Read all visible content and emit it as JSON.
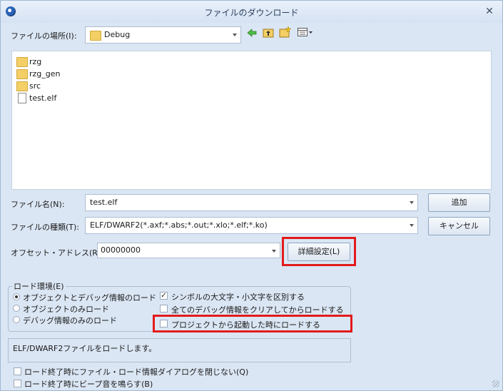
{
  "window": {
    "title": "ファイルのダウンロード",
    "close_glyph": "✕"
  },
  "location": {
    "label": "ファイルの場所(I):",
    "value": "Debug"
  },
  "toolbar": {
    "icons": [
      "back-arrow-icon",
      "up-folder-icon",
      "new-folder-icon",
      "view-menu-icon"
    ]
  },
  "files": [
    {
      "name": "rzg",
      "type": "folder"
    },
    {
      "name": "rzg_gen",
      "type": "folder"
    },
    {
      "name": "src",
      "type": "folder"
    },
    {
      "name": "test.elf",
      "type": "file"
    }
  ],
  "filename": {
    "label": "ファイル名(N):",
    "value": "test.elf"
  },
  "filetype": {
    "label": "ファイルの種類(T):",
    "value": "ELF/DWARF2(*.axf;*.abs;*.out;*.xlo;*.elf;*.ko)"
  },
  "offset": {
    "label": "オフセット・アドレス(R):",
    "value": "00000000"
  },
  "buttons": {
    "add": "追加",
    "cancel": "キャンセル",
    "details": "詳細設定(L)"
  },
  "load_env": {
    "title": "ロード環境(E)",
    "radios": [
      {
        "label": "オブジェクトとデバッグ情報のロード",
        "selected": true
      },
      {
        "label": "オブジェクトのみロード",
        "selected": false
      },
      {
        "label": "デバッグ情報のみのロード",
        "selected": false
      }
    ],
    "checks": [
      {
        "label": "シンボルの大文字・小文字を区別する",
        "checked": true
      },
      {
        "label": "全てのデバッグ情報をクリアしてからロードする",
        "checked": false
      },
      {
        "label": "プロジェクトから起動した時にロードする",
        "checked": false
      }
    ]
  },
  "status_text": "ELF/DWARF2ファイルをロードします。",
  "bottom_checks": [
    {
      "label": "ロード終了時にファイル・ロード情報ダイアログを閉じない(Q)",
      "checked": false
    },
    {
      "label": "ロード終了時にビープ音を鳴らす(B)",
      "checked": false
    }
  ],
  "colors": {
    "window_bg": "#dbe6f4",
    "highlight_red": "#e21b1b"
  }
}
